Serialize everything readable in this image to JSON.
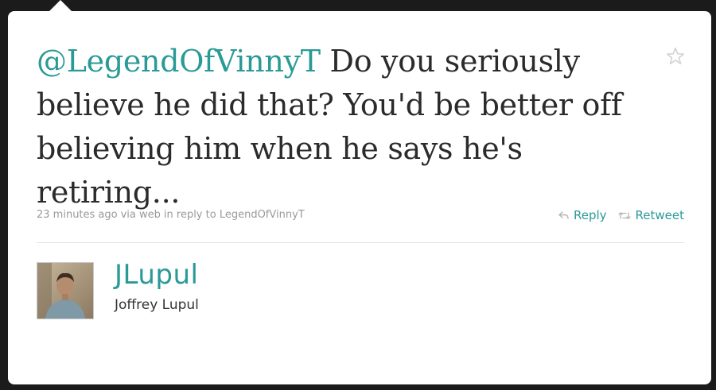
{
  "tweet": {
    "mention": "@LegendOfVinnyT",
    "text": " Do you seriously believe he did that? You'd be better off believing him when he says he's retiring...",
    "timestamp": "23 minutes ago",
    "via_label": "via web",
    "in_reply_to_label": "in reply to LegendOfVinnyT"
  },
  "actions": {
    "reply_label": "Reply",
    "retweet_label": "Retweet"
  },
  "author": {
    "username": "JLupul",
    "full_name": "Joffrey Lupul"
  },
  "icons": {
    "favorite": "star-icon",
    "reply": "reply-arrow-icon",
    "retweet": "retweet-icon"
  },
  "colors": {
    "accent": "#2a9a97",
    "text": "#2b2b2b",
    "meta": "#9a9a9a",
    "background": "#1b1b1b",
    "card": "#ffffff"
  }
}
